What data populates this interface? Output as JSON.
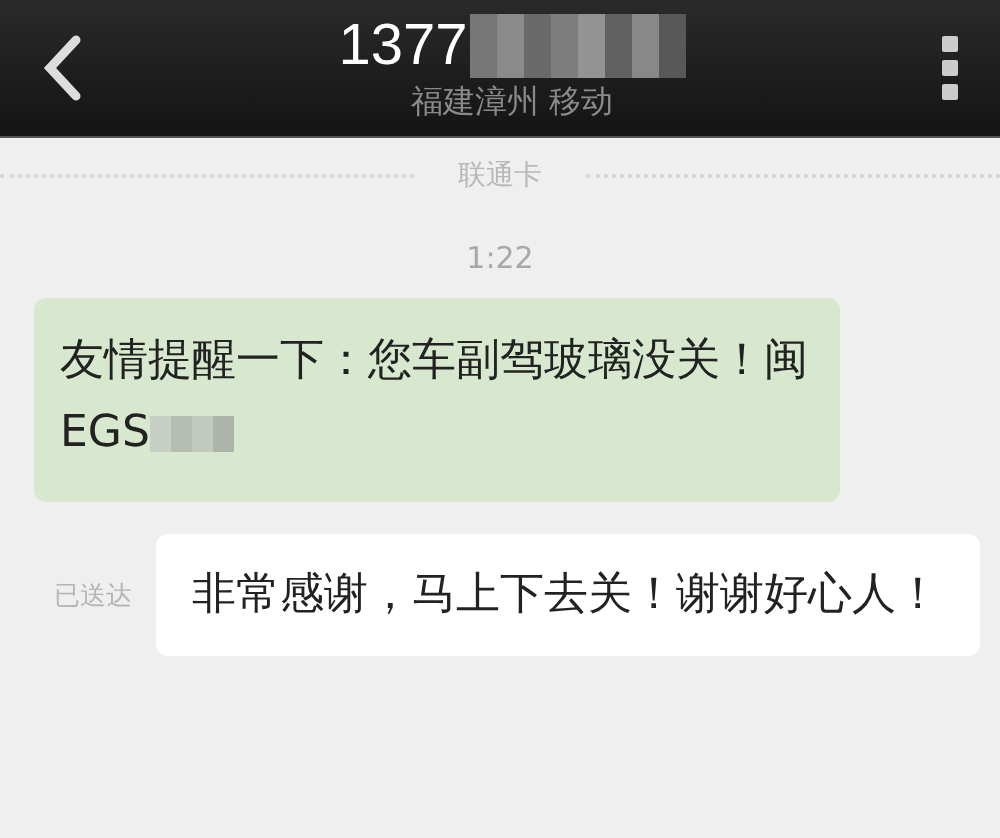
{
  "header": {
    "title": "1377",
    "subtitle": "福建漳州 移动"
  },
  "sim_label": "联通卡",
  "timestamp": "1:22",
  "messages": [
    {
      "kind": "incoming",
      "text": "友情提醒一下：您车副驾玻璃没关！闽EGS",
      "redacted": true
    },
    {
      "kind": "outgoing",
      "text": "非常感谢，马上下去关！谢谢好心人！",
      "status": "已送达"
    }
  ]
}
